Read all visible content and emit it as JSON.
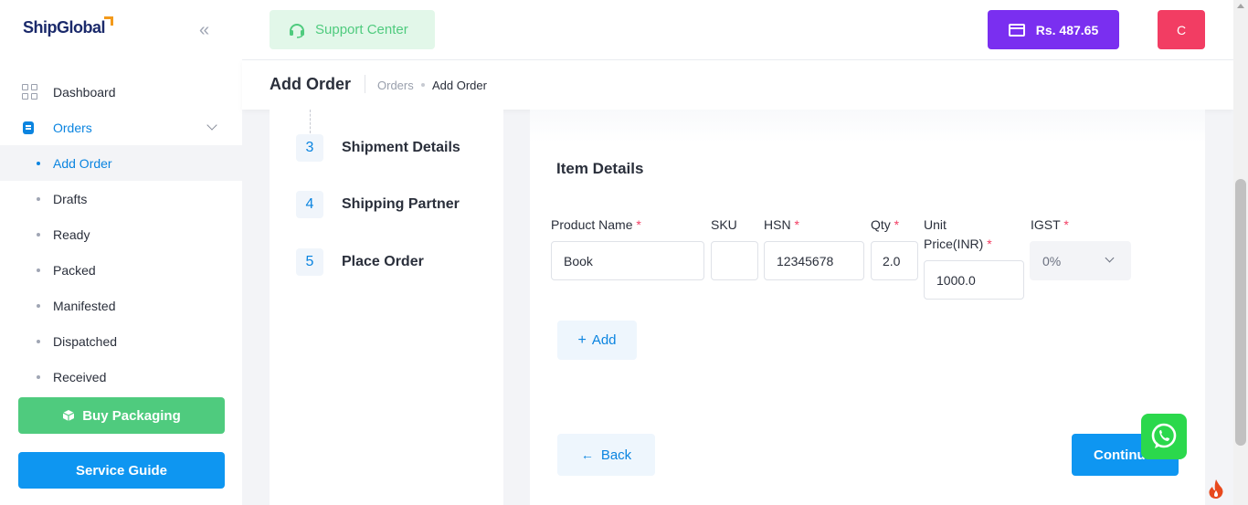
{
  "brand": {
    "name": "ShipGlobal"
  },
  "sidebar": {
    "collapse_icon": "double-chevron-left-icon",
    "items": [
      {
        "label": "Dashboard",
        "icon": "grid-icon"
      },
      {
        "label": "Orders",
        "icon": "orders-icon"
      }
    ],
    "sub_items": [
      {
        "label": "Add Order",
        "current": true
      },
      {
        "label": "Drafts"
      },
      {
        "label": "Ready"
      },
      {
        "label": "Packed"
      },
      {
        "label": "Manifested"
      },
      {
        "label": "Dispatched"
      },
      {
        "label": "Received"
      }
    ],
    "buy_packaging_label": "Buy Packaging",
    "service_guide_label": "Service Guide"
  },
  "topbar": {
    "support_label": "Support Center",
    "wallet_label": "Rs. 487.65",
    "avatar_initial": "C"
  },
  "header": {
    "title": "Add Order",
    "breadcrumb": [
      "Orders",
      "Add Order"
    ]
  },
  "steps": [
    {
      "number": "3",
      "label": "Shipment Details"
    },
    {
      "number": "4",
      "label": "Shipping Partner"
    },
    {
      "number": "5",
      "label": "Place Order"
    }
  ],
  "item_details": {
    "title": "Item Details",
    "labels": {
      "product_name": "Product Name",
      "sku": "SKU",
      "hsn": "HSN",
      "qty": "Qty",
      "unit_price_1": "Unit",
      "unit_price_2": "Price(INR)",
      "igst": "IGST"
    },
    "required_mark": "*",
    "values": {
      "product_name": "Book",
      "sku": "",
      "hsn": "12345678",
      "qty": "2.0",
      "unit_price": "1000.0",
      "igst": "0%"
    },
    "add_label": "Add",
    "back_label": "Back",
    "continue_label": "Continue"
  },
  "colors": {
    "primary": "#0e96f1",
    "green": "#4fcb7e",
    "wallet": "#7a2ff0",
    "avatar": "#f23d63",
    "required": "#f23d63"
  }
}
